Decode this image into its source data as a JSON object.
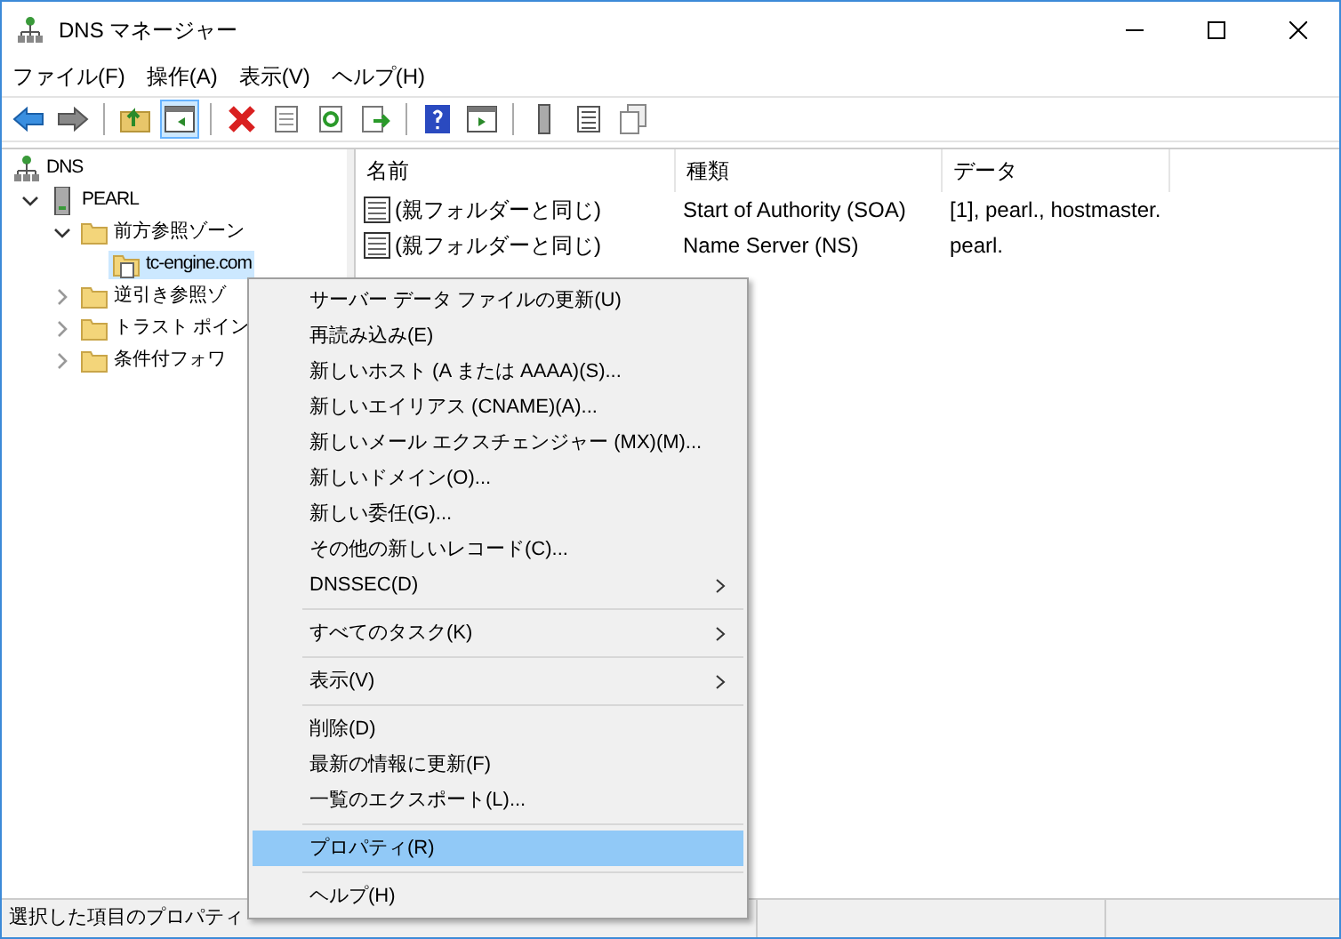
{
  "window": {
    "title": "DNS マネージャー"
  },
  "menubar": [
    "ファイル(F)",
    "操作(A)",
    "表示(V)",
    "ヘルプ(H)"
  ],
  "toolbar": [
    {
      "kind": "back",
      "selected": false
    },
    {
      "kind": "forward",
      "selected": false
    },
    {
      "kind": "separator"
    },
    {
      "kind": "up",
      "selected": false
    },
    {
      "kind": "tree",
      "selected": true
    },
    {
      "kind": "separator"
    },
    {
      "kind": "delete",
      "selected": false
    },
    {
      "kind": "properties",
      "selected": false
    },
    {
      "kind": "refresh",
      "selected": false
    },
    {
      "kind": "export",
      "selected": false
    },
    {
      "kind": "separator"
    },
    {
      "kind": "help",
      "selected": false
    },
    {
      "kind": "action",
      "selected": false
    },
    {
      "kind": "separator"
    },
    {
      "kind": "server",
      "selected": false
    },
    {
      "kind": "list",
      "selected": false
    },
    {
      "kind": "copy",
      "selected": false
    }
  ],
  "tree": [
    {
      "label": "DNS",
      "kind": "dns",
      "selected": false,
      "children": [
        {
          "label": "PEARL",
          "kind": "server",
          "selected": false,
          "expanded": true,
          "children": [
            {
              "label": "前方参照ゾーン",
              "kind": "folder",
              "selected": false,
              "expanded": true,
              "children": [
                {
                  "label": "tc-engine.com",
                  "kind": "zone",
                  "selected": true
                }
              ]
            },
            {
              "label": "逆引き参照ゾ",
              "kind": "folder",
              "selected": false,
              "expanded": false
            },
            {
              "label": "トラスト ポイン",
              "kind": "folder",
              "selected": false,
              "expanded": false
            },
            {
              "label": "条件付フォワ",
              "kind": "folder",
              "selected": false,
              "expanded": false
            }
          ]
        }
      ]
    }
  ],
  "list": {
    "columns": [
      "名前",
      "種類",
      "データ"
    ],
    "rows": [
      [
        "(親フォルダーと同じ)",
        "Start of Authority (SOA)",
        "[1], pearl., hostmaster."
      ],
      [
        "(親フォルダーと同じ)",
        "Name Server (NS)",
        "pearl."
      ]
    ]
  },
  "context_menu": {
    "groups": [
      [
        {
          "label": "サーバー データ ファイルの更新(U)",
          "submenu": false,
          "selected": false
        },
        {
          "label": "再読み込み(E)",
          "submenu": false,
          "selected": false
        },
        {
          "label": "新しいホスト (A または AAAA)(S)...",
          "submenu": false,
          "selected": false
        },
        {
          "label": "新しいエイリアス (CNAME)(A)...",
          "submenu": false,
          "selected": false
        },
        {
          "label": "新しいメール エクスチェンジャー (MX)(M)...",
          "submenu": false,
          "selected": false
        },
        {
          "label": "新しいドメイン(O)...",
          "submenu": false,
          "selected": false
        },
        {
          "label": "新しい委任(G)...",
          "submenu": false,
          "selected": false
        },
        {
          "label": "その他の新しいレコード(C)...",
          "submenu": false,
          "selected": false
        },
        {
          "label": "DNSSEC(D)",
          "submenu": true,
          "selected": false
        }
      ],
      [
        {
          "label": "すべてのタスク(K)",
          "submenu": true,
          "selected": false
        }
      ],
      [
        {
          "label": "表示(V)",
          "submenu": true,
          "selected": false
        }
      ],
      [
        {
          "label": "削除(D)",
          "submenu": false,
          "selected": false
        },
        {
          "label": "最新の情報に更新(F)",
          "submenu": false,
          "selected": false
        },
        {
          "label": "一覧のエクスポート(L)...",
          "submenu": false,
          "selected": false
        }
      ],
      [
        {
          "label": "プロパティ(R)",
          "submenu": false,
          "selected": true
        }
      ],
      [
        {
          "label": "ヘルプ(H)",
          "submenu": false,
          "selected": false
        }
      ]
    ]
  },
  "status_bar": {
    "text": "選択した項目のプロパティ"
  }
}
